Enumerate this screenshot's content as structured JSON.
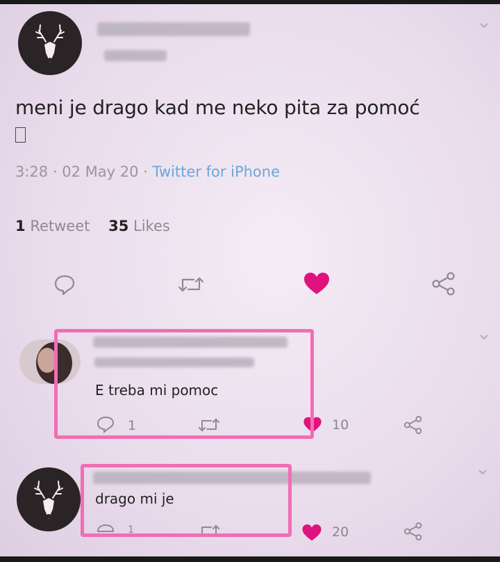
{
  "tweet": {
    "text": "meni je drago kad me neko pita za pomoć",
    "emoji_glyph": "□",
    "time": "3:28",
    "date": "02 May 20",
    "separator": "·",
    "source": "Twitter for iPhone",
    "retweets_count": "1",
    "retweets_label": "Retweet",
    "likes_count": "35",
    "likes_label": "Likes",
    "liked": true
  },
  "replies": [
    {
      "text": "E treba mi pomoc",
      "reply_count": "1",
      "like_count": "10",
      "liked": true
    },
    {
      "text": "drago mi je",
      "reply_count": "1",
      "like_count": "20",
      "liked": true
    }
  ],
  "colors": {
    "background": "#efe4f1",
    "accent_like": "#e0127e",
    "highlight": "#f06eb4",
    "link": "#6aa7d8",
    "muted": "#9a949e"
  },
  "icons": [
    "reply-icon",
    "retweet-icon",
    "heart-icon",
    "share-icon",
    "chevron-down-icon",
    "deer-avatar-icon"
  ]
}
